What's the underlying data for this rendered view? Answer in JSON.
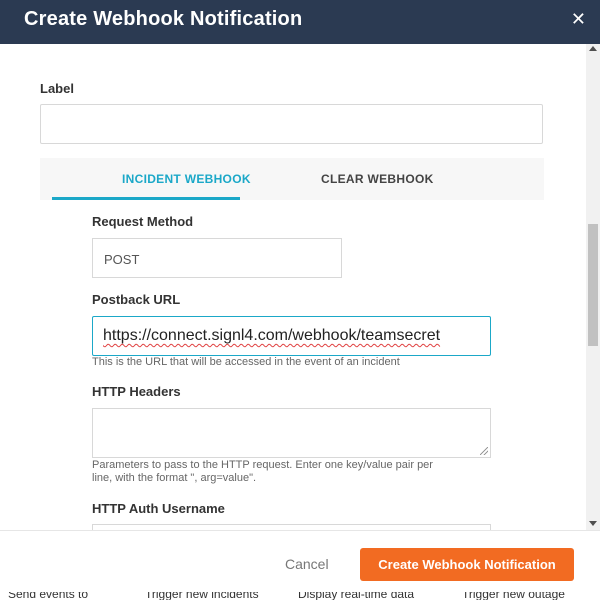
{
  "modal": {
    "title": "Create Webhook Notification",
    "close_icon": "close-icon"
  },
  "form": {
    "label_title": "Label",
    "label_value": "",
    "tabs": [
      {
        "label": "INCIDENT WEBHOOK",
        "active": true
      },
      {
        "label": "CLEAR WEBHOOK",
        "active": false
      }
    ],
    "request_method_label": "Request Method",
    "request_method_value": "POST",
    "postback_url_label": "Postback URL",
    "postback_url_value": "https://connect.signl4.com/webhook/teamsecret",
    "postback_url_help": "This is the URL that will be accessed in the event of an incident",
    "http_headers_label": "HTTP Headers",
    "http_headers_value": "",
    "http_headers_help_1": "Parameters to pass to the HTTP request. Enter one key/value pair per",
    "http_headers_help_2": "line, with the format \", arg=value\".",
    "auth_username_label": "HTTP Auth Username"
  },
  "footer": {
    "cancel_label": "Cancel",
    "create_label": "Create Webhook Notification"
  },
  "background_text": [
    "Send events to",
    "Trigger new incidents",
    "Display real-time data",
    "Trigger new outage"
  ],
  "colors": {
    "header_bg": "#2b3a52",
    "accent": "#1ba8c8",
    "primary_button": "#f26b22"
  }
}
